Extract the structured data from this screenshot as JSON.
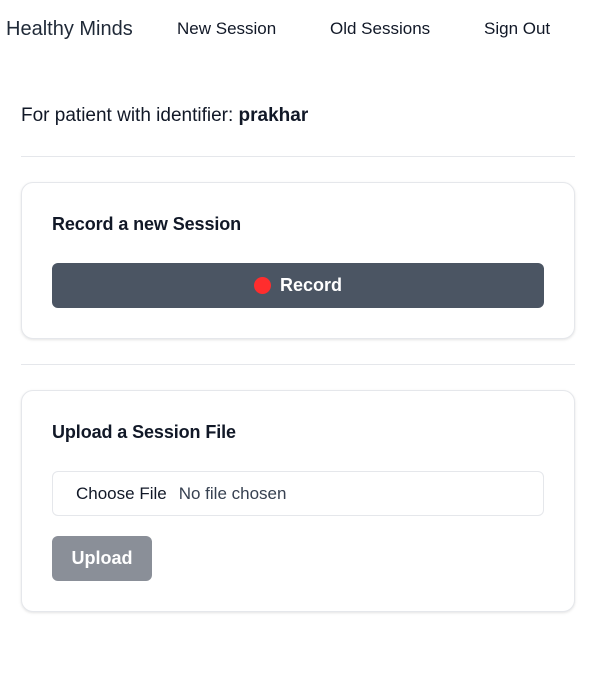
{
  "nav": {
    "brand": "Healthy Minds",
    "links": [
      {
        "label": "New Session"
      },
      {
        "label": "Old Sessions"
      },
      {
        "label": "Sign Out"
      }
    ]
  },
  "patient": {
    "prefix": "For patient with identifier: ",
    "identifier": "prakhar"
  },
  "record_card": {
    "title": "Record a new Session",
    "button_label": "Record",
    "dot_color": "#ff2d2d"
  },
  "upload_card": {
    "title": "Upload a Session File",
    "choose_file_label": "Choose File",
    "file_status": "No file chosen",
    "upload_label": "Upload"
  }
}
